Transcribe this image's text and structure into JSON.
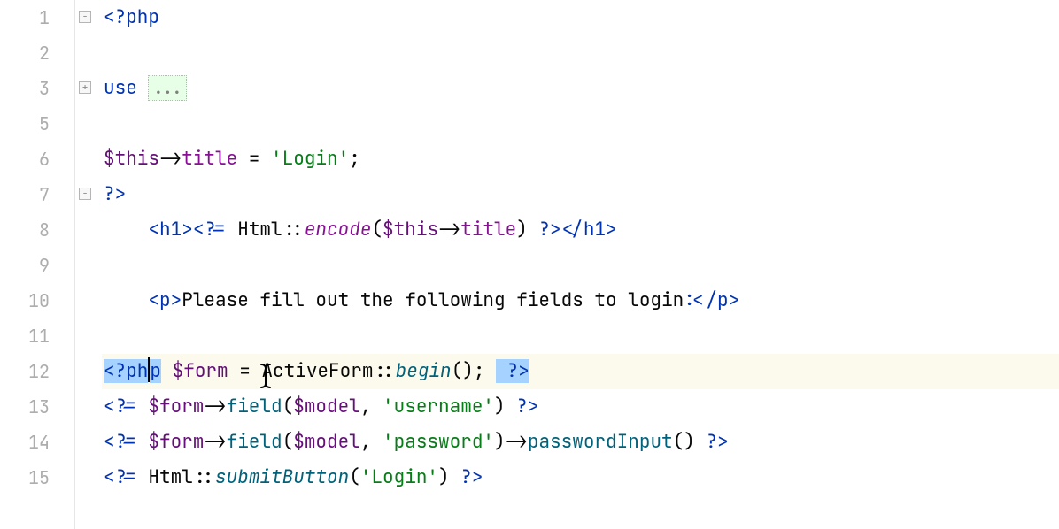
{
  "gutter": {
    "lines": [
      "1",
      "2",
      "3",
      "5",
      "6",
      "7",
      "8",
      "9",
      "10",
      "11",
      "12",
      "13",
      "14",
      "15"
    ]
  },
  "code": {
    "l1_open": "<?php",
    "l3_use": "use ",
    "l3_fold": "...",
    "l6_this": "$this",
    "l6_arrow": "->",
    "l6_title": "title",
    "l6_eq": " = ",
    "l6_str": "'Login'",
    "l6_semi": ";",
    "l7_close": "?>",
    "l8_indent": "    ",
    "l8_h1o": "<h1>",
    "l8_php": "<?= ",
    "l8_html": "Html",
    "l8_dcolon": "::",
    "l8_encode": "encode",
    "l8_lp": "(",
    "l8_this": "$this",
    "l8_arrow": "->",
    "l8_title": "title",
    "l8_rp": ") ",
    "l8_phpend": "?>",
    "l8_h1c": "</h1>",
    "l10_indent": "    ",
    "l10_po": "<p>",
    "l10_text": "Please fill out the following fields to login:",
    "l10_pc": "</p>",
    "l12_open_a": "<?ph",
    "l12_open_b": "p",
    "l12_sp": " ",
    "l12_form": "$form",
    "l12_eq": " = ",
    "l12_af": "ActiveForm",
    "l12_dcolon": "::",
    "l12_begin": "begin",
    "l12_call": "(); ",
    "l12_sp2": " ",
    "l12_close": "?>",
    "l13_open": "<?= ",
    "l13_form": "$form",
    "l13_arrow": "->",
    "l13_field": "field",
    "l13_lp": "(",
    "l13_model": "$model",
    "l13_comma": ", ",
    "l13_str": "'username'",
    "l13_rp": ") ",
    "l13_close": "?>",
    "l14_open": "<?= ",
    "l14_form": "$form",
    "l14_arrow": "->",
    "l14_field": "field",
    "l14_lp": "(",
    "l14_model": "$model",
    "l14_comma": ", ",
    "l14_str": "'password'",
    "l14_rp": ")",
    "l14_arrow2": "->",
    "l14_pwd": "passwordInput",
    "l14_call": "() ",
    "l14_close": "?>",
    "l15_open": "<?= ",
    "l15_html": "Html",
    "l15_dcolon": "::",
    "l15_sb": "submitButton",
    "l15_lp": "(",
    "l15_str": "'Login'",
    "l15_rp": ") ",
    "l15_close": "?>"
  }
}
